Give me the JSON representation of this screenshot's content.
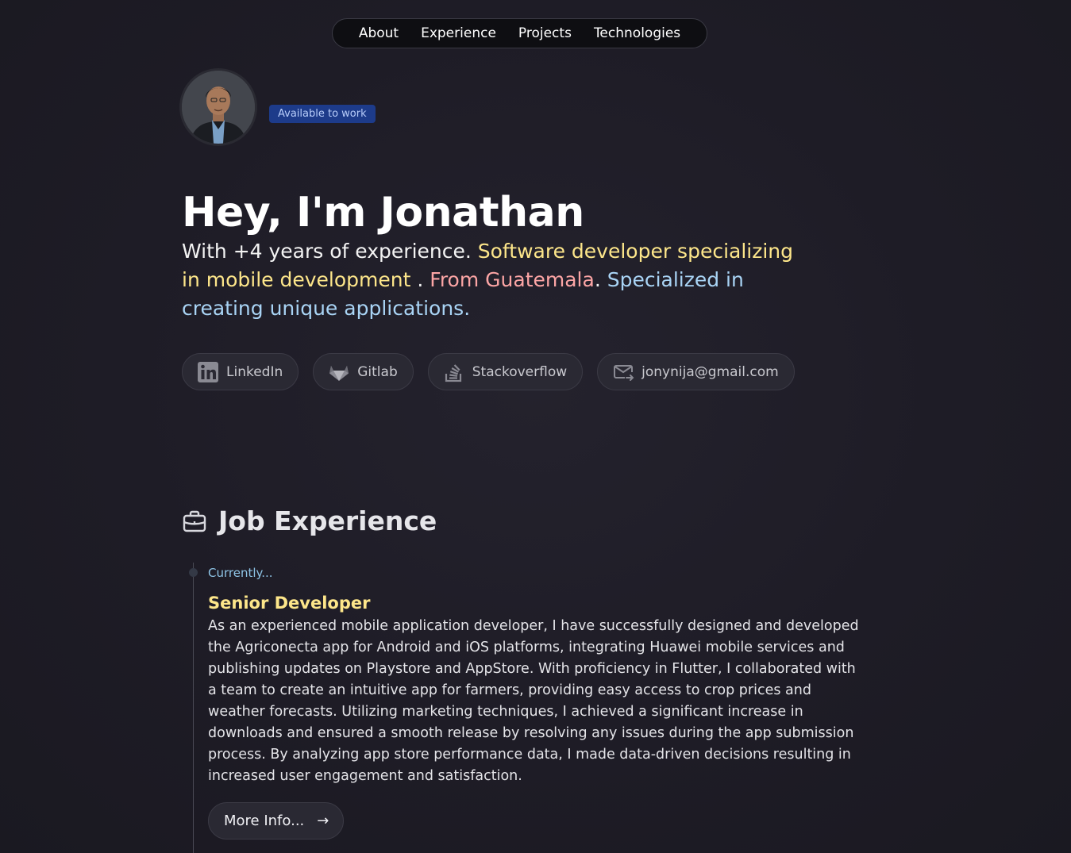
{
  "nav": {
    "items": [
      {
        "label": "About"
      },
      {
        "label": "Experience"
      },
      {
        "label": "Projects"
      },
      {
        "label": "Technologies"
      }
    ]
  },
  "profile": {
    "avatar_icon": "profile-photo",
    "status_badge": "Available to work"
  },
  "hero": {
    "title": "Hey, I'm Jonathan",
    "intro": "With +4 years of experience.",
    "specialty": "Software developer specializing in mobile development",
    "dot1": " .",
    "origin": "From Guatemala",
    "dot2": ".",
    "focus": "Specialized in creating unique applications."
  },
  "socials": [
    {
      "label": "LinkedIn",
      "icon": "linkedin-icon"
    },
    {
      "label": "Gitlab",
      "icon": "gitlab-icon"
    },
    {
      "label": "Stackoverflow",
      "icon": "stackoverflow-icon"
    },
    {
      "label": "jonynija@gmail.com",
      "icon": "mail-icon"
    }
  ],
  "experience": {
    "section_title": "Job Experience",
    "section_icon": "briefcase-icon",
    "jobs": [
      {
        "date": "Currently...",
        "role": "Senior Developer",
        "description": "As an experienced mobile application developer, I have successfully designed and developed the Agriconecta app for Android and iOS platforms, integrating Huawei mobile services and publishing updates on Playstore and AppStore. With proficiency in Flutter, I collaborated with a team to create an intuitive app for farmers, providing easy access to crop prices and weather forecasts. Utilizing marketing techniques, I achieved a significant increase in downloads and ensured a smooth release by resolving any issues during the app submission process. By analyzing app store performance data, I made data-driven decisions resulting in increased user engagement and satisfaction.",
        "more_label": "More Info...",
        "more_arrow": "→"
      }
    ]
  },
  "colors": {
    "accent_yellow": "#fde68a",
    "accent_pink": "#fca5a5",
    "accent_blue": "#a9d4f5",
    "badge_bg": "#1d3b8a"
  }
}
